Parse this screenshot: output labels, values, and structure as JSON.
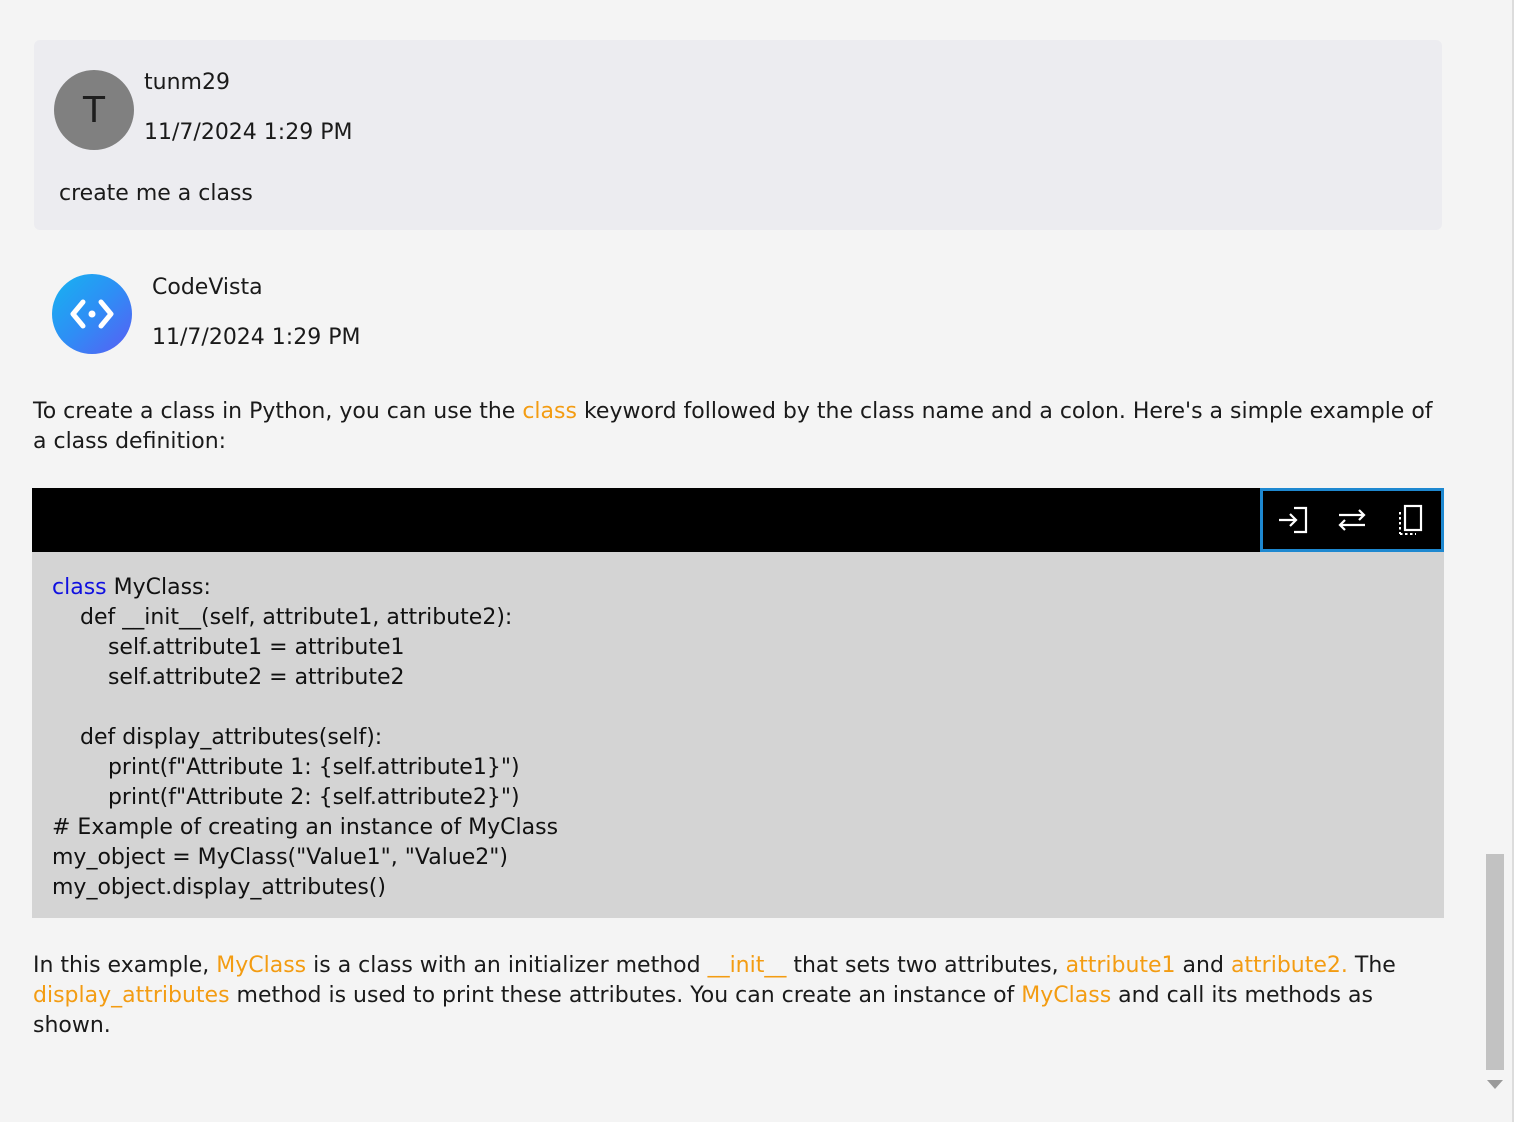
{
  "user_message": {
    "avatar_initial": "T",
    "name": "tunm29",
    "timestamp": "11/7/2024 1:29 PM",
    "text": "create me a class"
  },
  "bot_message": {
    "avatar_icon": "codevista-logo-icon",
    "name": "CodeVista",
    "timestamp": "11/7/2024 1:29 PM",
    "intro": {
      "p1": "To create a class in Python, you can use the ",
      "keyword": "class",
      "p2": " keyword followed by the class name and a colon. Here's a simple example of a class definition:"
    },
    "code_toolbar": {
      "insert_icon": "insert-code-icon",
      "replace_icon": "replace-code-icon",
      "copy_icon": "copy-code-icon"
    },
    "code": {
      "first_keyword": "class",
      "first_rest": " MyClass:",
      "rest": "    def __init__(self, attribute1, attribute2):\n        self.attribute1 = attribute1\n        self.attribute2 = attribute2\n\n    def display_attributes(self):\n        print(f\"Attribute 1: {self.attribute1}\")\n        print(f\"Attribute 2: {self.attribute2}\")\n# Example of creating an instance of MyClass\nmy_object = MyClass(\"Value1\", \"Value2\")\nmy_object.display_attributes()"
    },
    "outro": {
      "t1": "In this example, ",
      "h1": "MyClass",
      "t2": " is a class with an initializer method ",
      "h2": "__init__",
      "t3": " that sets two attributes, ",
      "h3": "attribute1",
      "t4": " and ",
      "h4": "attribute2.",
      "t5": " The ",
      "h5": "display_attributes",
      "t6": " method is used to print these attributes. You can create an instance of ",
      "h6": "MyClass",
      "t7": " and call its methods as shown."
    }
  },
  "colors": {
    "highlight": "#f39c12",
    "keyword": "#1010e0",
    "toolbar_border": "#1e88d0"
  }
}
